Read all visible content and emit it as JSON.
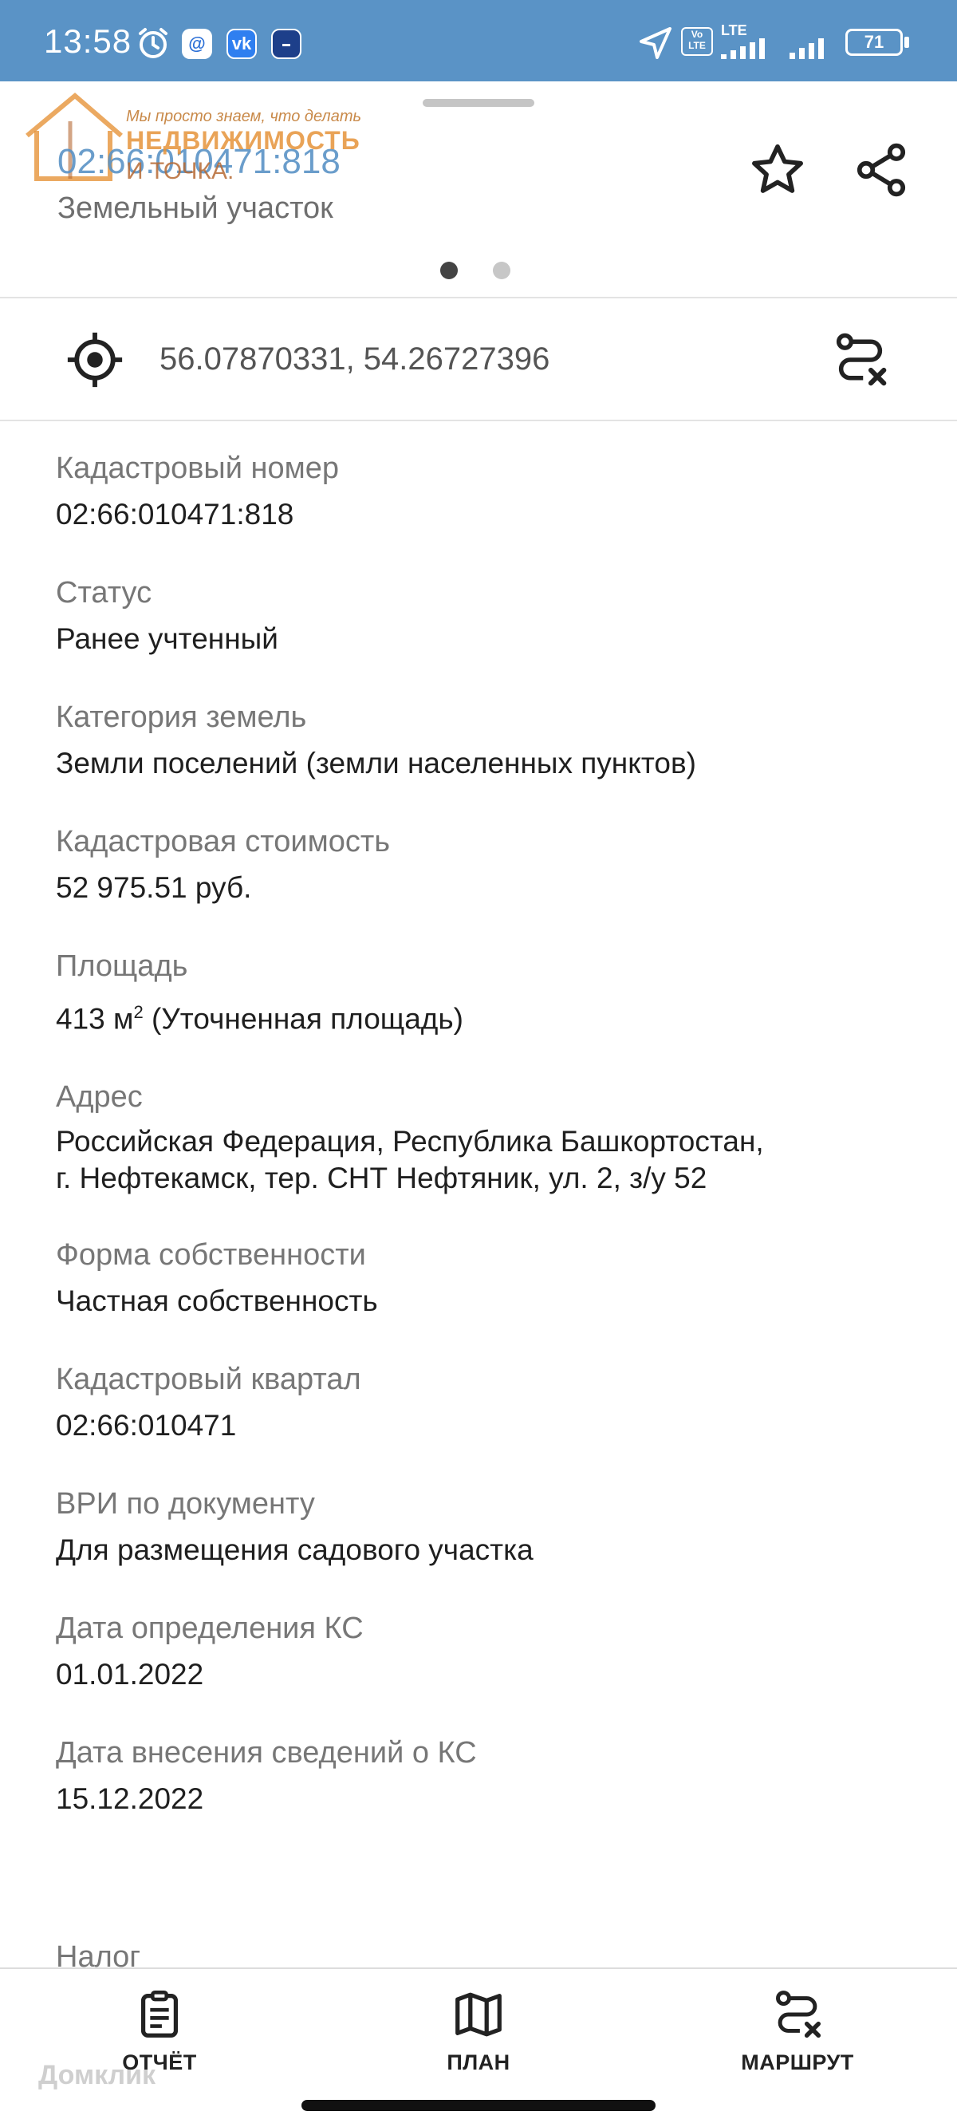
{
  "status_bar": {
    "time": "13:58",
    "network_label": "LTE",
    "volte_label": "Vo LTE",
    "battery": "71"
  },
  "header": {
    "watermark_top": "Мы просто знаем, что делать",
    "watermark_brand": "НЕДВИЖИМОСТЬ",
    "watermark_sub": "И ТОЧКА.",
    "title": "02:66:010471:818",
    "subtitle": "Земельный участок",
    "pager_dots": 2,
    "pager_active": 0
  },
  "coords": {
    "value": "56.07870331, 54.26727396"
  },
  "fields": [
    {
      "label": "Кадастровый номер",
      "value": "02:66:010471:818"
    },
    {
      "label": "Статус",
      "value": "Ранее учтенный"
    },
    {
      "label": "Категория земель",
      "value": "Земли поселений (земли населенных пунктов)"
    },
    {
      "label": "Кадастровая стоимость",
      "value": "52 975.51 руб."
    },
    {
      "label": "Площадь",
      "value_main": "413 м",
      "value_sup": "2",
      "value_rest": " (Уточненная площадь)"
    },
    {
      "label": "Адрес",
      "value": "Российская Федерация, Республика Башкортостан, г. Нефтекамск, тер. СНТ Нефтяник, ул. 2, з/у 52"
    },
    {
      "label": "Форма собственности",
      "value": "Частная собственность"
    },
    {
      "label": "Кадастровый квартал",
      "value": "02:66:010471"
    },
    {
      "label": "ВРИ по документу",
      "value": "Для размещения садового участка"
    },
    {
      "label": "Дата определения КС",
      "value": "01.01.2022"
    },
    {
      "label": "Дата внесения сведений о КС",
      "value": "15.12.2022"
    }
  ],
  "partial_label": "Налог",
  "bottom_nav": {
    "report": "ОТЧЁТ",
    "plan": "ПЛАН",
    "route": "МАРШРУТ"
  },
  "footer_watermark": "Домклик",
  "colors": {
    "status_bar": "#5a93c6",
    "accent": "#5a93c6",
    "watermark_orange": "#e6943a"
  }
}
